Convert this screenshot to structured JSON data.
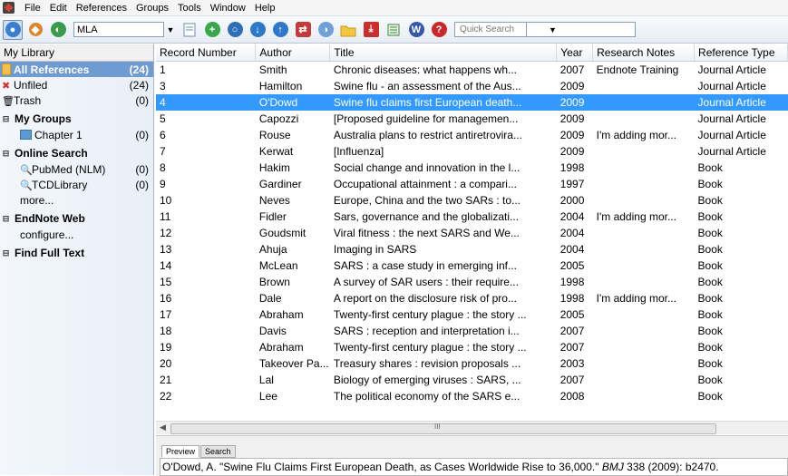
{
  "menu": {
    "items": [
      "File",
      "Edit",
      "References",
      "Groups",
      "Tools",
      "Window",
      "Help"
    ]
  },
  "toolbar": {
    "style": "MLA",
    "quick_search": "Quick Search"
  },
  "sidebar": {
    "header": "My Library",
    "items": [
      {
        "label": "All References",
        "count": "(24)"
      },
      {
        "label": "Unfiled",
        "count": "(24)"
      },
      {
        "label": "Trash",
        "count": "(0)"
      }
    ],
    "my_groups": {
      "title": "My Groups",
      "items": [
        {
          "label": "Chapter 1",
          "count": "(0)"
        }
      ]
    },
    "online_search": {
      "title": "Online Search",
      "items": [
        {
          "label": "PubMed (NLM)",
          "count": "(0)"
        },
        {
          "label": "TCDLibrary",
          "count": "(0)"
        }
      ],
      "more": "more..."
    },
    "endnote_web": {
      "title": "EndNote Web",
      "configure": "configure..."
    },
    "find_full_text": "Find Full Text"
  },
  "table": {
    "columns": [
      "Record Number",
      "Author",
      "Title",
      "Year",
      "Research Notes",
      "Reference Type"
    ],
    "rows": [
      [
        "1",
        "Smith",
        "Chronic diseases: what happens wh...",
        "2007",
        "Endnote Training",
        "Journal Article"
      ],
      [
        "3",
        "Hamilton",
        "Swine flu - an assessment of the Aus...",
        "2009",
        "",
        "Journal Article"
      ],
      [
        "4",
        "O'Dowd",
        "Swine flu claims first European death...",
        "2009",
        "",
        "Journal Article"
      ],
      [
        "5",
        "Capozzi",
        "[Proposed guideline for managemen...",
        "2009",
        "",
        "Journal Article"
      ],
      [
        "6",
        "Rouse",
        "Australia plans to restrict antiretrovira...",
        "2009",
        "I'm adding mor...",
        "Journal Article"
      ],
      [
        "7",
        "Kerwat",
        "[Influenza]",
        "2009",
        "",
        "Journal Article"
      ],
      [
        "8",
        "Hakim",
        "Social change and innovation in the l...",
        "1998",
        "",
        "Book"
      ],
      [
        "9",
        "Gardiner",
        "Occupational attainment : a compari...",
        "1997",
        "",
        "Book"
      ],
      [
        "10",
        "Neves",
        "Europe, China and the two SARs : to...",
        "2000",
        "",
        "Book"
      ],
      [
        "11",
        "Fidler",
        "Sars, governance and the globalizati...",
        "2004",
        "I'm adding mor...",
        "Book"
      ],
      [
        "12",
        "Goudsmit",
        "Viral fitness : the next SARS and We...",
        "2004",
        "",
        "Book"
      ],
      [
        "13",
        "Ahuja",
        "Imaging in SARS",
        "2004",
        "",
        "Book"
      ],
      [
        "14",
        "McLean",
        "SARS : a case study in emerging inf...",
        "2005",
        "",
        "Book"
      ],
      [
        "15",
        "Brown",
        "A survey of SAR users : their require...",
        "1998",
        "",
        "Book"
      ],
      [
        "16",
        "Dale",
        "A report on the disclosure risk of pro...",
        "1998",
        "I'm adding mor...",
        "Book"
      ],
      [
        "17",
        "Abraham",
        "Twenty-first century plague : the story ...",
        "2005",
        "",
        "Book"
      ],
      [
        "18",
        "Davis",
        "SARS : reception and interpretation i...",
        "2007",
        "",
        "Book"
      ],
      [
        "19",
        "Abraham",
        "Twenty-first century plague : the story ...",
        "2007",
        "",
        "Book"
      ],
      [
        "20",
        "Takeover Pa...",
        "Treasury shares : revision proposals ...",
        "2003",
        "",
        "Book"
      ],
      [
        "21",
        "Lal",
        "Biology of emerging viruses : SARS, ...",
        "2007",
        "",
        "Book"
      ],
      [
        "22",
        "Lee",
        "The political economy of the SARS e...",
        "2008",
        "",
        "Book"
      ]
    ],
    "selected_index": 2,
    "scroll_thumb_glyph": "III"
  },
  "preview": {
    "tabs": [
      "Preview",
      "Search"
    ],
    "text": "O'Dowd, A. \"Swine Flu Claims First European Death, as Cases Worldwide Rise to 36,000.\"",
    "journal": "BMJ",
    "text_tail": " 338  (2009): b2470."
  },
  "colors": {
    "selected_row": "#3399ff",
    "sidebar_selected": "#6f9bd3"
  }
}
